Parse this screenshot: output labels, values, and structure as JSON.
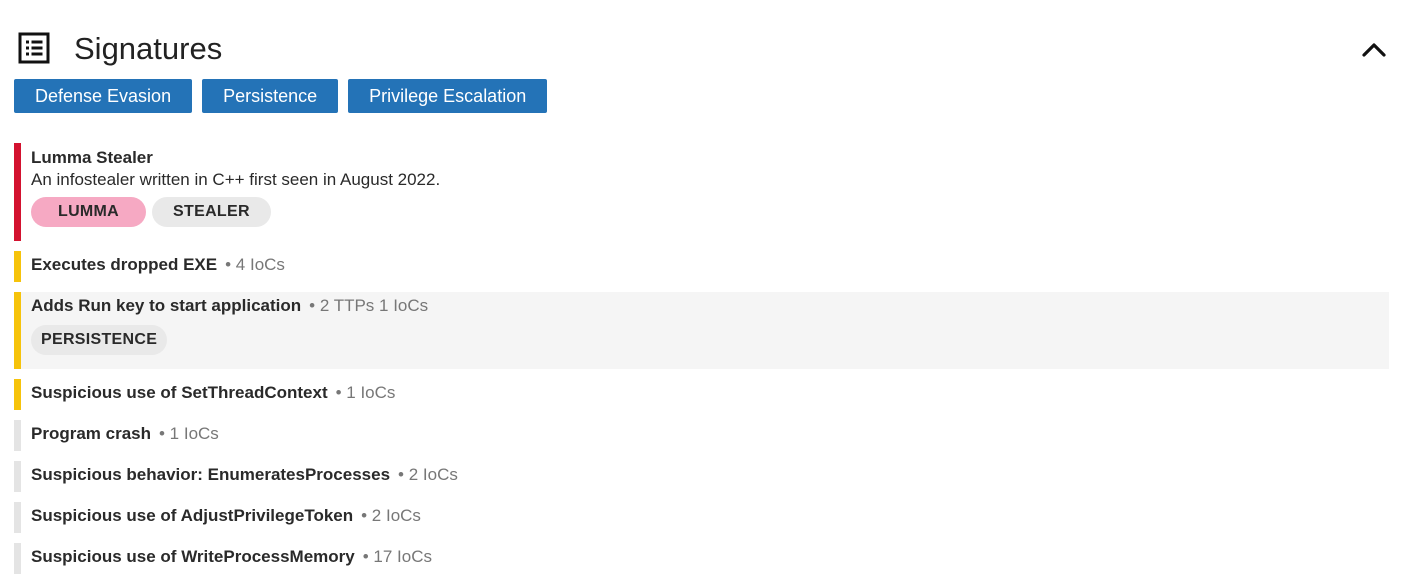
{
  "header": {
    "title": "Signatures",
    "list_icon": "list-icon",
    "collapse_icon": "chevron-up-icon"
  },
  "tactics": [
    {
      "label": "Defense Evasion"
    },
    {
      "label": "Persistence"
    },
    {
      "label": "Privilege Escalation"
    }
  ],
  "colors": {
    "accent": "#2473b7",
    "critical": "#d3122f",
    "warning": "#f6c30b",
    "neutral": "#e4e4e4",
    "lumma_tag": "#f6a9c3"
  },
  "signatures": [
    {
      "name": "Lumma Stealer",
      "description": "An infostealer written in C++ first seen in August 2022.",
      "severity_color": "#d3122f",
      "tags": [
        "LUMMA",
        "STEALER"
      ]
    },
    {
      "name": "Executes dropped EXE",
      "meta": "• 4 IoCs",
      "severity_color": "#f6c30b"
    },
    {
      "name": "Adds Run key to start application",
      "meta": "• 2 TTPs 1 IoCs",
      "severity_color": "#f6c30b",
      "tags": [
        "PERSISTENCE"
      ]
    },
    {
      "name": "Suspicious use of SetThreadContext",
      "meta": "• 1 IoCs",
      "severity_color": "#f6c30b"
    },
    {
      "name": "Program crash",
      "meta": "• 1 IoCs",
      "severity_color": "#e4e4e4"
    },
    {
      "name": "Suspicious behavior: EnumeratesProcesses",
      "meta": "• 2 IoCs",
      "severity_color": "#e4e4e4"
    },
    {
      "name": "Suspicious use of AdjustPrivilegeToken",
      "meta": "• 2 IoCs",
      "severity_color": "#e4e4e4"
    },
    {
      "name": "Suspicious use of WriteProcessMemory",
      "meta": "• 17 IoCs",
      "severity_color": "#e4e4e4"
    }
  ]
}
